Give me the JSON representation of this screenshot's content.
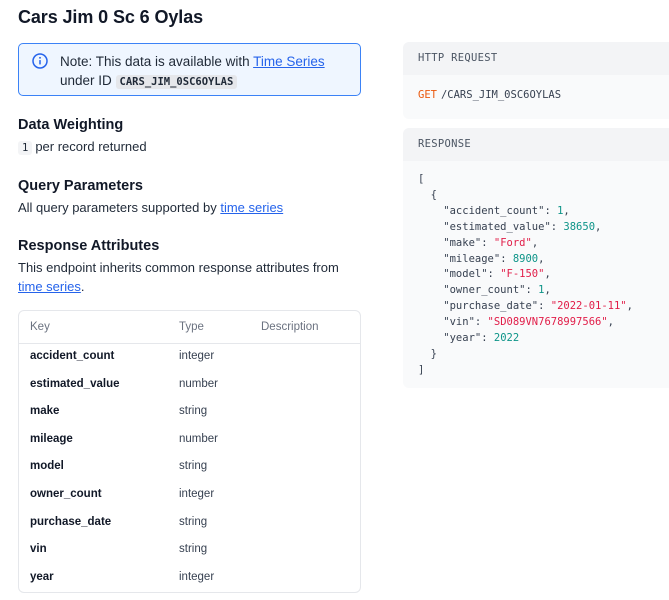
{
  "page": {
    "title": "Cars Jim 0 Sc 6 Oylas"
  },
  "note": {
    "prefix": "Note: This data is available with ",
    "link_text": "Time Series",
    "middle": " under ID ",
    "id_code": "CARS_JIM_0SC6OYLAS"
  },
  "weighting": {
    "heading": "Data Weighting",
    "value": "1",
    "text": "per record returned"
  },
  "query": {
    "heading": "Query Parameters",
    "text": "All query parameters supported by ",
    "link": "time series"
  },
  "response_attrs": {
    "heading": "Response Attributes",
    "text": "This endpoint inherits common response attributes from ",
    "link": "time series",
    "suffix": ".",
    "columns": [
      "Key",
      "Type",
      "Description"
    ],
    "rows": [
      {
        "key": "accident_count",
        "type": "integer"
      },
      {
        "key": "estimated_value",
        "type": "number"
      },
      {
        "key": "make",
        "type": "string"
      },
      {
        "key": "mileage",
        "type": "number"
      },
      {
        "key": "model",
        "type": "string"
      },
      {
        "key": "owner_count",
        "type": "integer"
      },
      {
        "key": "purchase_date",
        "type": "string"
      },
      {
        "key": "vin",
        "type": "string"
      },
      {
        "key": "year",
        "type": "integer"
      }
    ]
  },
  "http_request": {
    "label": "HTTP REQUEST",
    "method": "GET",
    "path": "/CARS_JIM_0SC6OYLAS"
  },
  "response": {
    "label": "RESPONSE",
    "fields": [
      {
        "key": "accident_count",
        "value": "1",
        "kind": "num"
      },
      {
        "key": "estimated_value",
        "value": "38650",
        "kind": "num"
      },
      {
        "key": "make",
        "value": "\"Ford\"",
        "kind": "str"
      },
      {
        "key": "mileage",
        "value": "8900",
        "kind": "num"
      },
      {
        "key": "model",
        "value": "\"F-150\"",
        "kind": "str"
      },
      {
        "key": "owner_count",
        "value": "1",
        "kind": "num"
      },
      {
        "key": "purchase_date",
        "value": "\"2022-01-11\"",
        "kind": "str"
      },
      {
        "key": "vin",
        "value": "\"SD089VN7678997566\"",
        "kind": "str"
      },
      {
        "key": "year",
        "value": "2022",
        "kind": "num"
      }
    ]
  },
  "colors": {
    "accent": "#2563eb",
    "note_border": "#3b82f6",
    "method": "#ea580c",
    "json_number": "#0d9488",
    "json_string": "#e11d48"
  },
  "icons": {
    "note": "info-circle-icon"
  }
}
